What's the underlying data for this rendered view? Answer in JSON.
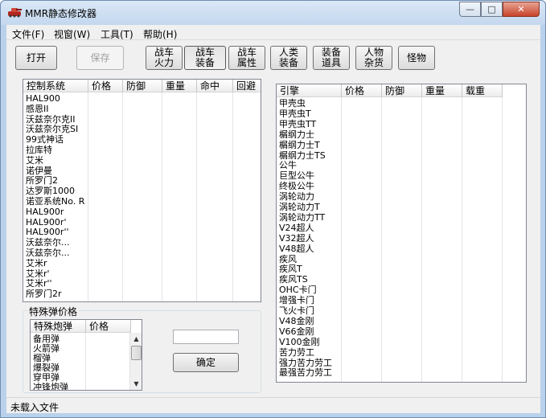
{
  "window": {
    "title": "MMR静态修改器"
  },
  "menu": [
    "文件(F)",
    "视窗(W)",
    "工具(T)",
    "帮助(H)"
  ],
  "toolbar": {
    "open": "打开",
    "save": "保存",
    "cat1": [
      "战车",
      "火力"
    ],
    "cat2": [
      "战车",
      "装备"
    ],
    "cat3": [
      "战车",
      "属性"
    ],
    "cat4": [
      "人类",
      "装备"
    ],
    "cat5": [
      "装备",
      "道具"
    ],
    "cat6": [
      "人物",
      "杂货"
    ],
    "monster": "怪物"
  },
  "left_table": {
    "headers": [
      "控制系统",
      "价格",
      "防御",
      "重量",
      "命中",
      "回避"
    ],
    "rows": [
      "HAL900",
      "感恩II",
      "沃兹奈尔克II",
      "沃兹奈尔克SI",
      "99式神话",
      "拉库特",
      "艾米",
      "诺伊曼",
      "所罗门2",
      "达罗斯1000",
      "诺亚系统No. R",
      "HAL900r",
      "HAL900r'",
      "HAL900r''",
      "沃兹奈尔...",
      "沃兹奈尔...",
      "艾米r",
      "艾米r'",
      "艾米r''",
      "所罗门2r"
    ]
  },
  "special": {
    "group_label": "特殊弹价格",
    "headers": [
      "特殊炮弹",
      "价格"
    ],
    "rows": [
      "备用弹",
      "火箭弹",
      "榴弹",
      "爆裂弹",
      "穿甲弹",
      "冲锋炮弹"
    ]
  },
  "confirm": "确定",
  "input_value": "",
  "right_table": {
    "headers": [
      "引擎",
      "价格",
      "防御",
      "重量",
      "载重"
    ],
    "rows": [
      "甲壳虫",
      "甲壳虫T",
      "甲壳虫TT",
      "榍纲力士",
      "榍纲力士T",
      "榍纲力士TS",
      "公牛",
      "巨型公牛",
      "终极公牛",
      "涡轮动力",
      "涡轮动力T",
      "涡轮动力TT",
      "V24超人",
      "V32超人",
      "V48超人",
      "疾风",
      "疾风T",
      "疾风TS",
      "OHC卡门",
      "增强卡门",
      "飞火卡门",
      "V48金刚",
      "V66金刚",
      "V100金刚",
      "苦力劳工",
      "强力苦力劳工",
      "最强苦力劳工"
    ]
  },
  "status": "未载入文件"
}
